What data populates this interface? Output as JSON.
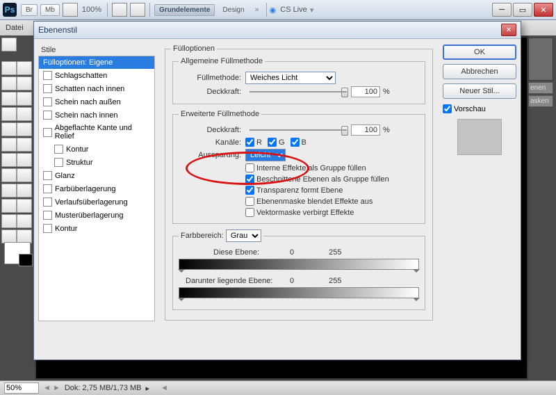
{
  "titlebar": {
    "zoom": "100%",
    "grundelemente": "Grundelemente",
    "design": "Design",
    "cslive": "CS Live"
  },
  "menubar": {
    "datei": "Datei"
  },
  "dialog": {
    "title": "Ebenenstil"
  },
  "styles": {
    "header": "Stile",
    "items": [
      {
        "label": "Fülloptionen: Eigene",
        "sel": true,
        "cb": false
      },
      {
        "label": "Schlagschatten",
        "cb": true
      },
      {
        "label": "Schatten nach innen",
        "cb": true
      },
      {
        "label": "Schein nach außen",
        "cb": true
      },
      {
        "label": "Schein nach innen",
        "cb": true
      },
      {
        "label": "Abgeflachte Kante und Relief",
        "cb": true
      },
      {
        "label": "Kontur",
        "cb": true,
        "sub": true
      },
      {
        "label": "Struktur",
        "cb": true,
        "sub": true
      },
      {
        "label": "Glanz",
        "cb": true
      },
      {
        "label": "Farbüberlagerung",
        "cb": true
      },
      {
        "label": "Verlaufsüberlagerung",
        "cb": true
      },
      {
        "label": "Musterüberlagerung",
        "cb": true
      },
      {
        "label": "Kontur",
        "cb": true
      }
    ]
  },
  "fill": {
    "groupTitle": "Fülloptionen",
    "general": {
      "title": "Allgemeine Füllmethode",
      "fillmethod_lbl": "Füllmethode:",
      "fillmethod_val": "Weiches Licht",
      "opacity_lbl": "Deckkraft:",
      "opacity_val": "100",
      "pct": "%"
    },
    "advanced": {
      "title": "Erweiterte Füllmethode",
      "opacity_lbl": "Deckkraft:",
      "opacity_val": "100",
      "pct": "%",
      "channels_lbl": "Kanäle:",
      "R": "R",
      "G": "G",
      "B": "B",
      "knockout_lbl": "Aussparung:",
      "knockout_val": "Leicht",
      "opts": [
        "Interne Effekte als Gruppe füllen",
        "Beschnittene Ebenen als Gruppe füllen",
        "Transparenz formt Ebene",
        "Ebenenmaske blendet Effekte aus",
        "Vektormaske verbirgt Effekte"
      ],
      "checked": [
        false,
        true,
        true,
        false,
        false
      ]
    },
    "blendif": {
      "title": "Farbbereich:",
      "channel": "Grau",
      "thislayer_lbl": "Diese Ebene:",
      "thislow": "0",
      "thishigh": "255",
      "under_lbl": "Darunter liegende Ebene:",
      "underlow": "0",
      "underhigh": "255"
    }
  },
  "buttons": {
    "ok": "OK",
    "cancel": "Abbrechen",
    "newstyle": "Neuer Stil...",
    "preview": "Vorschau"
  },
  "status": {
    "zoom": "50%",
    "doc": "Dok: 2,75 MB/1,73 MB"
  },
  "rightpanel": {
    "tab1": "enen",
    "tab2": "asken"
  }
}
